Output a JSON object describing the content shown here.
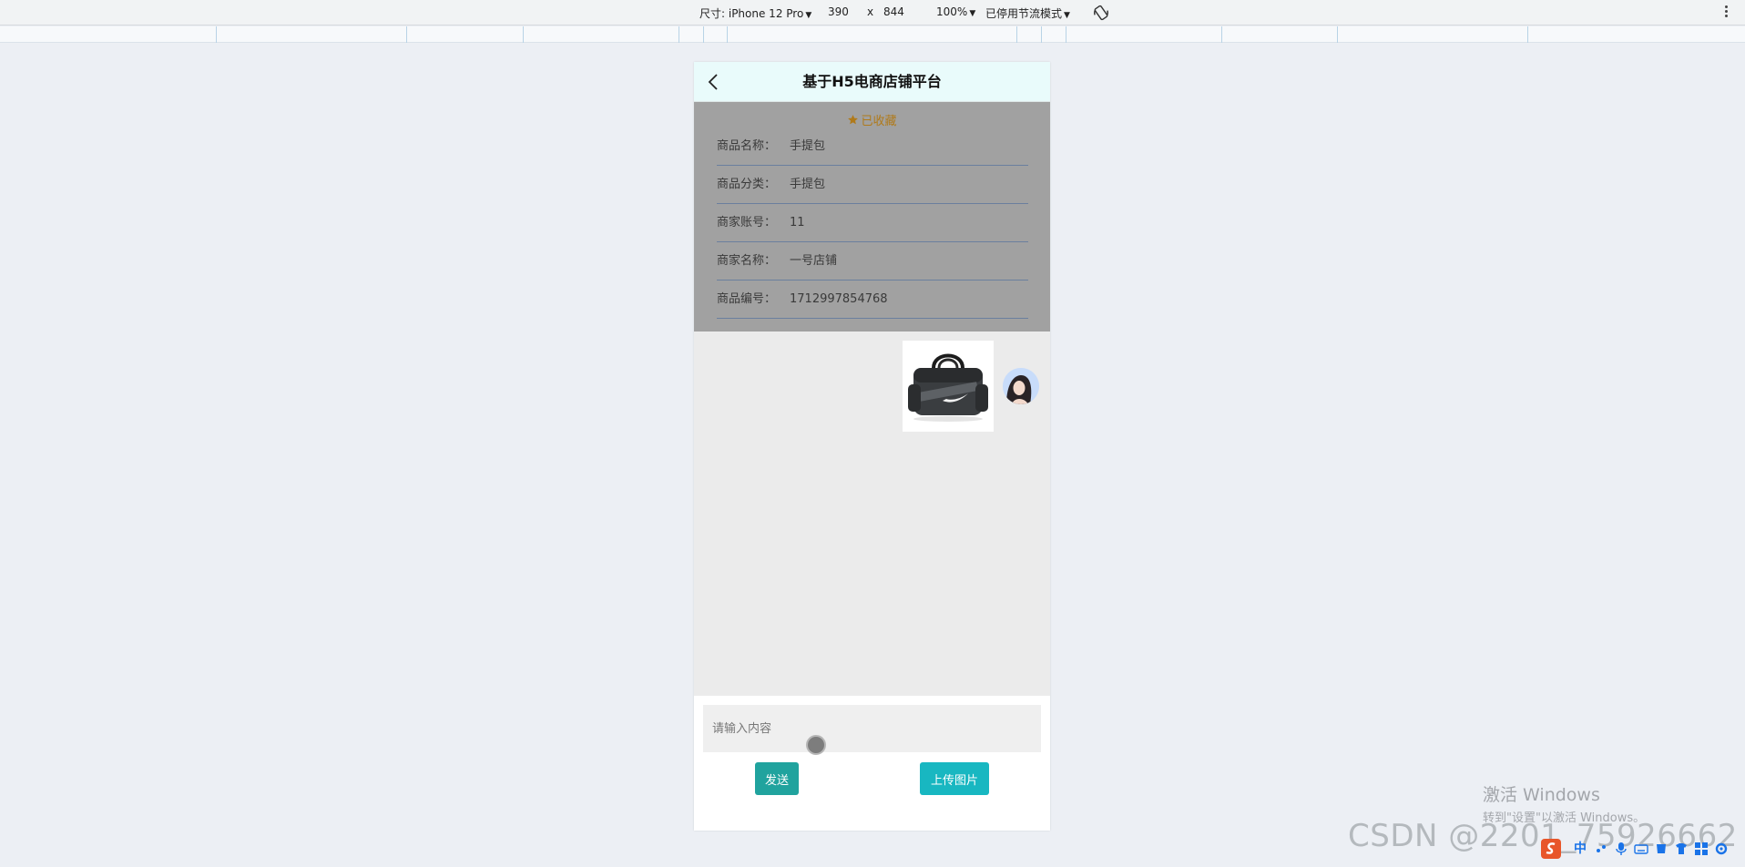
{
  "devtools": {
    "device_label": "尺寸: iPhone 12 Pro",
    "width": "390",
    "times": "x",
    "height": "844",
    "zoom": "100%",
    "throttle": "已停用节流模式"
  },
  "app": {
    "title": "基于H5电商店铺平台",
    "favorite_label": "已收藏",
    "fields": [
      {
        "label": "商品名称：",
        "value": "手提包"
      },
      {
        "label": "商品分类：",
        "value": "手提包"
      },
      {
        "label": "商家账号：",
        "value": "11"
      },
      {
        "label": "商家名称：",
        "value": "一号店铺"
      },
      {
        "label": "商品编号：",
        "value": "1712997854768"
      }
    ],
    "input_placeholder": "请输入内容",
    "send_label": "发送",
    "upload_label": "上传图片"
  },
  "watermark": {
    "line1": "激活 Windows",
    "line2": "转到\"设置\"以激活 Windows。",
    "csdn": "CSDN @2201_75926662"
  },
  "taskbar": {
    "ime": "中"
  },
  "colors": {
    "send_button": "#20a39e",
    "upload_button": "#18b7c1",
    "favorite": "#b07a1a"
  }
}
